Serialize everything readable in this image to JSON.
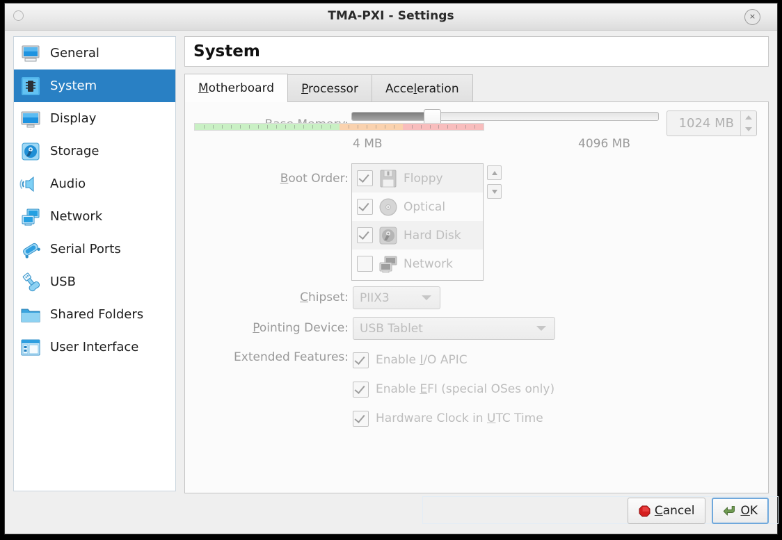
{
  "window": {
    "title": "TMA-PXI - Settings",
    "close_label": "×"
  },
  "sidebar": {
    "items": [
      {
        "label": "General",
        "icon": "monitor-icon",
        "selected": false
      },
      {
        "label": "System",
        "icon": "chip-icon",
        "selected": true
      },
      {
        "label": "Display",
        "icon": "display-icon",
        "selected": false
      },
      {
        "label": "Storage",
        "icon": "harddisk-icon",
        "selected": false
      },
      {
        "label": "Audio",
        "icon": "speaker-icon",
        "selected": false
      },
      {
        "label": "Network",
        "icon": "network-icon",
        "selected": false
      },
      {
        "label": "Serial Ports",
        "icon": "serial-port-icon",
        "selected": false
      },
      {
        "label": "USB",
        "icon": "usb-icon",
        "selected": false
      },
      {
        "label": "Shared Folders",
        "icon": "folder-icon",
        "selected": false
      },
      {
        "label": "User Interface",
        "icon": "user-interface-icon",
        "selected": false
      }
    ]
  },
  "page": {
    "title": "System",
    "tabs": [
      {
        "label": "Motherboard",
        "mnemonic": "M",
        "active": true
      },
      {
        "label": "Processor",
        "mnemonic": "P",
        "active": false
      },
      {
        "label": "Acceleration",
        "mnemonic": "l",
        "active": false
      }
    ]
  },
  "motherboard": {
    "base_memory": {
      "label_pre": "Base ",
      "label_mnemonic": "M",
      "label_post": "emory:",
      "min_label": "4 MB",
      "max_label": "4096 MB",
      "value_label": "1024 MB",
      "value_mb": 1024,
      "min_mb": 4,
      "max_mb": 4096,
      "handle_percent": 26,
      "green_percent": 50,
      "orange_percent": 22,
      "red_percent": 28,
      "green_color": "#c9f0c4",
      "orange_color": "#fad2ae",
      "red_color": "#f8bdbd"
    },
    "boot_order": {
      "label_mnemonic": "B",
      "label_post": "oot Order:",
      "items": [
        {
          "label": "Floppy",
          "icon": "floppy-icon",
          "checked": true
        },
        {
          "label": "Optical",
          "icon": "optical-icon",
          "checked": true
        },
        {
          "label": "Hard Disk",
          "icon": "harddisk-icon",
          "checked": true
        },
        {
          "label": "Network",
          "icon": "network-icon",
          "checked": false
        }
      ],
      "move_up_label": "Move Up",
      "move_down_label": "Move Down"
    },
    "chipset": {
      "label_mnemonic": "C",
      "label_post": "hipset:",
      "value": "PIIX3"
    },
    "pointing_device": {
      "label_mnemonic": "P",
      "label_post": "ointing Device:",
      "value": "USB Tablet"
    },
    "extended_features": {
      "label": "Extended Features:",
      "items": [
        {
          "pre": "Enable ",
          "mnemonic": "I",
          "post": "/O APIC",
          "checked": true
        },
        {
          "pre": "Enable ",
          "mnemonic": "E",
          "post": "FI (special OSes only)",
          "checked": true
        },
        {
          "pre": "Hardware Clock in ",
          "mnemonic": "U",
          "post": "TC Time",
          "checked": true
        }
      ]
    }
  },
  "buttons": {
    "cancel": {
      "pre": "",
      "mnemonic": "C",
      "post": "ancel",
      "icon": "cancel-icon"
    },
    "ok": {
      "pre": "",
      "mnemonic": "O",
      "post": "K",
      "icon": "ok-arrow-icon"
    }
  }
}
